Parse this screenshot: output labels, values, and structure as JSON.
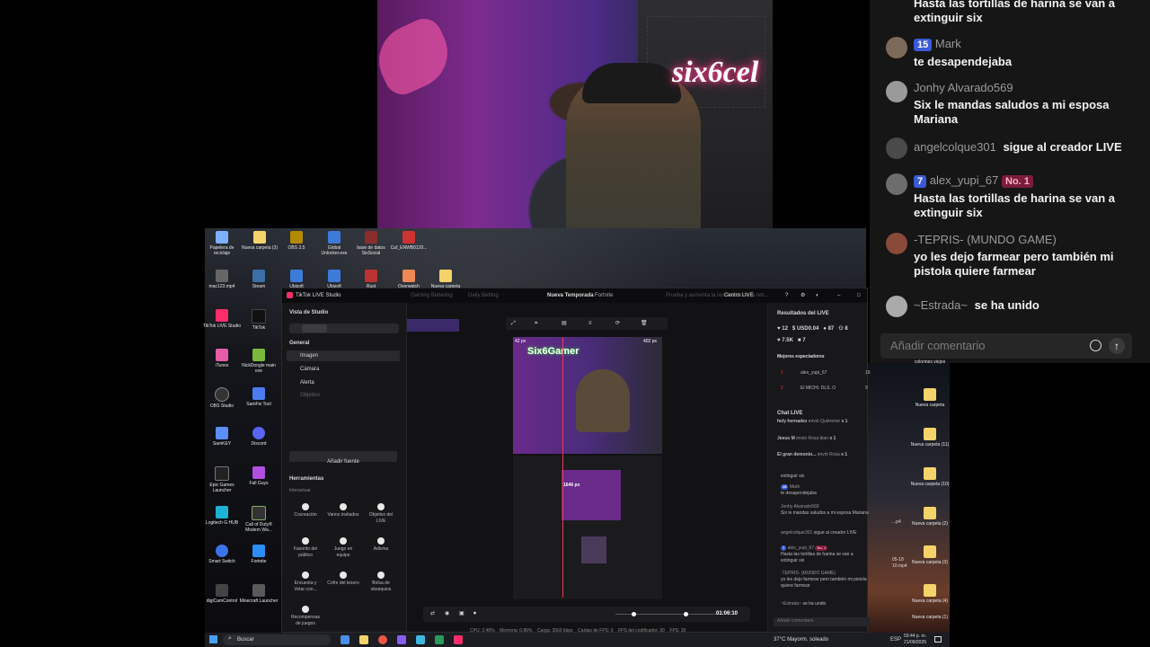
{
  "webcam": {
    "sign_text": "six6cel"
  },
  "overlay_chat": {
    "messages": [
      {
        "text": "Hasta las tortillas de harina se van a extinguir six"
      },
      {
        "level": "15",
        "name": "Mark",
        "text": "te desapendejaba"
      },
      {
        "name": "Jonhy Alvarado569",
        "text": "Six le mandas saludos a mi esposa Mariana"
      },
      {
        "name": "angelcolque301",
        "text": "sigue al creador LIVE"
      },
      {
        "level": "7",
        "name": "alex_yupi_67",
        "badge": "No. 1",
        "text": "Hasta las tortillas de harina se van a extinguir six"
      },
      {
        "name": "-TEPRIS- (MUNDO GAME)",
        "text": "yo les dejo farmear pero también mi pistola quiere farmear"
      },
      {
        "name": "~Estrada~",
        "text": "se ha unido"
      }
    ],
    "input_placeholder": "Añadir comentario",
    "colors": {
      "level_badge": "#3a5ad8",
      "rank_badge": "#7a1d3a"
    }
  },
  "desktop": {
    "top_icons": [
      {
        "label": "Papelera de reciclaje",
        "color": "#7ab0ff"
      },
      {
        "label": "Nueva carpeta (3)",
        "color": "#f5d36b"
      },
      {
        "label": "OBS 3.5",
        "color": "#b38a00"
      },
      {
        "label": "Global Unlocker.exe",
        "color": "#3d7bd8"
      },
      {
        "label": "base de datos SixSocial",
        "color": "#8a2d2d"
      },
      {
        "label": "Caf_ENWB0120...",
        "color": "#cc3333"
      }
    ],
    "second_row": [
      {
        "label": "mac123.mp4",
        "color": "#666"
      },
      {
        "label": "Steam",
        "color": "#3d6ea8"
      },
      {
        "label": "Ubisoft",
        "color": "#3d7bd8"
      },
      {
        "label": "Ubisoft",
        "color": "#3d7bd8"
      },
      {
        "label": "Rust",
        "color": "#b33"
      },
      {
        "label": "Overwatch",
        "color": "#e85"
      },
      {
        "label": "Nueva carpeta",
        "color": "#f5d36b"
      }
    ],
    "left_icons": [
      {
        "label": "TikTok LIVE Studio",
        "color": "#ff2d6a"
      },
      {
        "label": "TikTok",
        "color": "#111"
      },
      {
        "label": "iTunes",
        "color": "#e65ca8"
      },
      {
        "label": "NickDongle main exe",
        "color": "#7aba3a"
      },
      {
        "label": "OBS Studio",
        "color": "#333"
      },
      {
        "label": "SamFw Tool",
        "color": "#4d7cf0"
      },
      {
        "label": "SamKEY",
        "color": "#5b8ef7"
      },
      {
        "label": "Discord",
        "color": "#5865f2"
      },
      {
        "label": "Epic Games Launcher",
        "color": "#222"
      },
      {
        "label": "Fall Guys",
        "color": "#b04fe0"
      },
      {
        "label": "Logitech G HUB",
        "color": "#1db3d6"
      },
      {
        "label": "Call of Duty® Modern Wa...",
        "color": "#333"
      },
      {
        "label": "Smart Switch",
        "color": "#3b74e8"
      },
      {
        "label": "Fortnite",
        "color": "#2a8ef5"
      },
      {
        "label": "digiCamControl",
        "color": "#444"
      },
      {
        "label": "Minecraft Launcher",
        "color": "#5a5a5a"
      }
    ],
    "right_icons": [
      {
        "label": "colorines viejos"
      },
      {
        "label": "Nueva carpeta"
      },
      {
        "label": "Nueva carpeta (11)"
      },
      {
        "label": "Nueva carpeta (10)"
      },
      {
        "label": "Nueva carpeta (2)"
      },
      {
        "label": "Nueva carpeta (3)"
      },
      {
        "label": "Nueva carpeta (4)"
      },
      {
        "label": "Nueva carpeta (1)"
      }
    ],
    "side_files": [
      "...p4",
      "05-18",
      "10.mp4"
    ]
  },
  "studio": {
    "app_title": "TikTok LIVE Studio",
    "tabs": [
      "Gaming Bettering",
      "Daily Betting"
    ],
    "window_title": "Nueva Temporada",
    "window_subtitle": "Fortnite",
    "notice": "Prueba y aumenta la resolución de la retr...",
    "center_button": "Centro LIVE",
    "view_label": "Vista de Studio",
    "general_label": "General",
    "sources": [
      "Imagen",
      "Cámara",
      "Alerta",
      "Objetivo"
    ],
    "add_source": "Añadir fuente",
    "tools_title": "Herramientas",
    "tools_subtitle": "Interactuar",
    "tools": [
      "Cocreación",
      "Varios invitados",
      "Objetivo del LIVE",
      "Favorito del público",
      "Juego en equipo",
      "Adivina",
      "Encuesta y Votar con...",
      "Cofre del tesoro",
      "Bolsa de obsequios",
      "Recompensas de juegos"
    ],
    "preview": {
      "left_dim": "42 px",
      "right_dim": "402 px",
      "bottom_dim": "1646 px",
      "overlay_text": "Six6Gamer"
    },
    "timer": "01:06:10",
    "status_bar": [
      "CPU: 2.48%",
      "Memoria: 0.86%",
      "Carga: 3560 kbps",
      "Caídas de FPS: 0",
      "FPS del codificador: 30",
      "FPS: 30"
    ],
    "results": {
      "title": "Resultados del LIVE",
      "stats": [
        "12",
        "USD0.04",
        "87",
        "8",
        "7.5K",
        "7"
      ],
      "viewers_title": "Mejores espectadores",
      "viewers": [
        {
          "rank": "1",
          "name": "alex_yupi_67",
          "score": "19"
        },
        {
          "rank": "2",
          "name": "El MICHI. DLS. O",
          "score": "9"
        }
      ]
    },
    "chat_title": "Chat LIVE",
    "gifts": [
      {
        "user": "hely hernadez",
        "action": "envió Quiéreme",
        "count": "x 1"
      },
      {
        "user": "Jesus M",
        "action": "envió Rosa blan",
        "count": "x 1"
      },
      {
        "user": "El gran demonio...",
        "action": "envió Rosa",
        "count": "x 1"
      }
    ],
    "chat": [
      {
        "text": "extinguir six"
      },
      {
        "level": "15",
        "name": "Mark",
        "text": "te desapendejaba"
      },
      {
        "name": "Jonhy Alvarado569",
        "text": "Six le mandas saludos a mi esposa Mariana"
      },
      {
        "name": "angelcolque301",
        "text": "sigue al creador LIVE"
      },
      {
        "level": "7",
        "name": "alex_yupi_67",
        "badge": "No. 1",
        "text": "Hasta las tortillas de harina se van a extinguir six"
      },
      {
        "name": "-TEPRIS- (MUNDO GAME)",
        "text": "yo les dejo farmear pero también mi pistola quiere farmear"
      },
      {
        "name": "~Estrada~",
        "text": "se ha unido"
      }
    ],
    "chat_placeholder": "Añadir comentario"
  },
  "taskbar": {
    "search_placeholder": "Buscar",
    "weather": "37°C Mayorm. soleado",
    "lang": "ESP",
    "time": "03:44 p. m.",
    "date": "21/09/2025"
  }
}
